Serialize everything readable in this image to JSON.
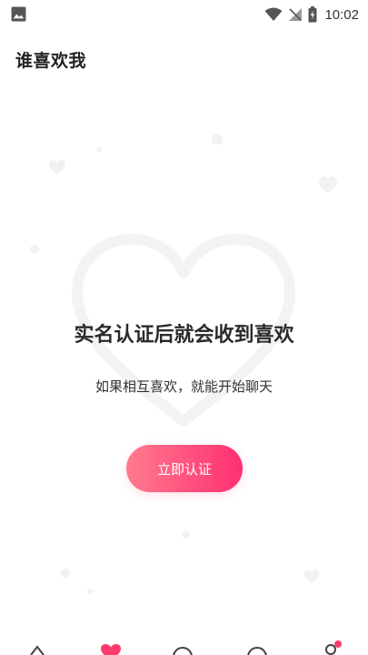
{
  "status_bar": {
    "time": "10:02",
    "icons": [
      "image-icon",
      "wifi-icon",
      "signal-off-icon",
      "battery-charging-icon"
    ]
  },
  "header": {
    "title": "谁喜欢我"
  },
  "empty_state": {
    "headline": "实名认证后就会收到喜欢",
    "subline": "如果相互喜欢，就能开始聊天",
    "button_label": "立即认证"
  },
  "tab_bar": {
    "tabs": [
      {
        "icon": "home-icon",
        "active": false
      },
      {
        "icon": "heart-icon",
        "active": true
      },
      {
        "icon": "chat-icon",
        "active": false
      },
      {
        "icon": "discover-icon",
        "active": false
      },
      {
        "icon": "profile-icon",
        "active": false,
        "badge_dot": true
      }
    ]
  },
  "colors": {
    "accent_start": "#ff7b8e",
    "accent_end": "#ff2f72",
    "active_tab": "#ff3b6e"
  }
}
